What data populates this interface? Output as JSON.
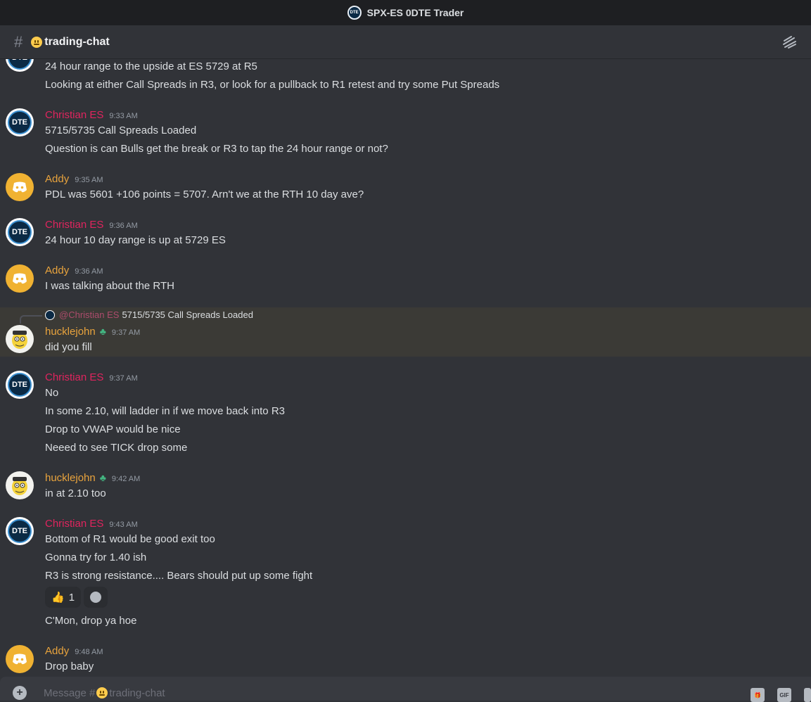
{
  "app": {
    "server_title": "SPX-ES 0DTE Trader",
    "server_icon_text": "DTE"
  },
  "channel": {
    "name": "trading-chat",
    "hash": "#"
  },
  "reply": {
    "mention": "@Christian ES",
    "text": "5715/5735 Call Spreads Loaded"
  },
  "messages": [
    {
      "lines": [
        "24 hour range to the upside at ES 5729 at R5",
        "Looking at either Call Spreads in R3, or look for a pullback to R1 retest and try some Put Spreads"
      ]
    },
    {
      "author": "Christian ES",
      "time": "9:33 AM",
      "lines": [
        "5715/5735 Call Spreads Loaded",
        "Question is can Bulls get the break or R3 to tap the 24 hour range or not?"
      ]
    },
    {
      "author": "Addy",
      "time": "9:35 AM",
      "lines": [
        "PDL was 5601 +106 points = 5707.  Arn't we at the RTH 10 day ave?"
      ]
    },
    {
      "author": "Christian ES",
      "time": "9:36 AM",
      "lines": [
        "24 hour 10 day range is up at 5729 ES"
      ]
    },
    {
      "author": "Addy",
      "time": "9:36 AM",
      "lines": [
        "I was talking about the RTH"
      ]
    },
    {
      "author": "hucklejohn",
      "time": "9:37 AM",
      "lines": [
        "did you fill"
      ]
    },
    {
      "author": "Christian ES",
      "time": "9:37 AM",
      "lines": [
        "No",
        "In some 2.10, will ladder in if we move back into R3",
        "Drop to VWAP would be nice",
        "Neeed to see TICK drop some"
      ]
    },
    {
      "author": "hucklejohn",
      "time": "9:42 AM",
      "lines": [
        "in at 2.10 too"
      ]
    },
    {
      "author": "Christian ES",
      "time": "9:43 AM",
      "lines": [
        "Bottom of R1 would be good exit too",
        "Gonna try for 1.40 ish",
        "R3 is strong resistance.... Bears should put up some fight",
        "C'Mon, drop ya hoe"
      ]
    },
    {
      "author": "Addy",
      "time": "9:48 AM",
      "lines": [
        "Drop baby"
      ]
    }
  ],
  "reaction": {
    "emoji": "👍",
    "count": "1"
  },
  "composer": {
    "placeholder_prefix": "Message #",
    "placeholder_channel": "trading-chat",
    "gif_label": "GIF"
  },
  "colors": {
    "christian": "#e0245e",
    "addy": "#e8a33d",
    "hucklejohn": "#e8a33d",
    "background": "#313338"
  }
}
